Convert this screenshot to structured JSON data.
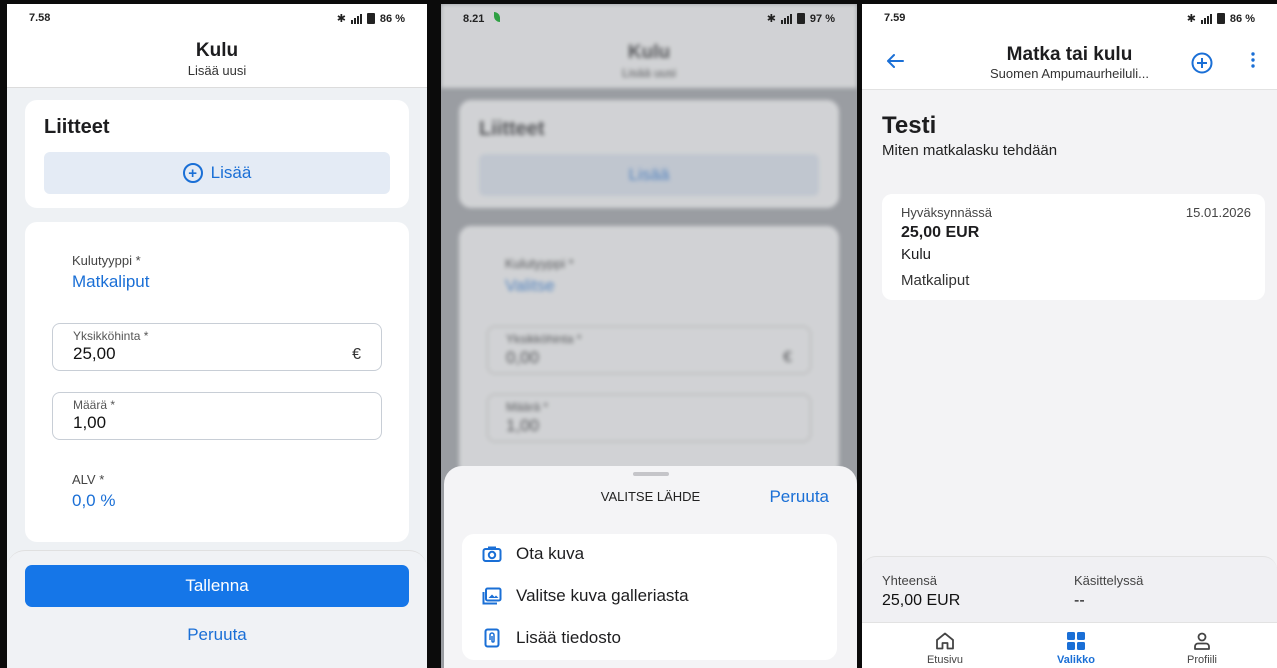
{
  "screen1": {
    "status": {
      "time": "7.58",
      "battery": "86 %"
    },
    "header": {
      "title": "Kulu",
      "subtitle": "Lisää uusi"
    },
    "attachments": {
      "title": "Liitteet",
      "add_label": "Lisää"
    },
    "form": {
      "expense_type": {
        "label": "Kulutyyppi *",
        "value": "Matkaliput"
      },
      "unit_price": {
        "label": "Yksikköhinta *",
        "value": "25,00",
        "unit": "€"
      },
      "quantity": {
        "label": "Määrä *",
        "value": "1,00"
      },
      "vat": {
        "label": "ALV *",
        "value": "0,0 %"
      }
    },
    "actions": {
      "save": "Tallenna",
      "cancel": "Peruuta"
    }
  },
  "screen2": {
    "status": {
      "time": "8.21",
      "battery": "97 %"
    },
    "background": {
      "title": "Kulu",
      "subtitle": "Lisää uusi",
      "attachments_title": "Liitteet",
      "add_label": "Lisää",
      "expense_type_label": "Kulutyyppi *",
      "expense_type_value": "Valitse",
      "unit_price_label": "Yksikköhinta *",
      "unit_price_value": "0,00",
      "unit": "€",
      "quantity_label": "Määrä *",
      "quantity_value": "1,00"
    },
    "sheet": {
      "title": "VALITSE LÄHDE",
      "cancel": "Peruuta",
      "options": [
        "Ota kuva",
        "Valitse kuva galleriasta",
        "Lisää tiedosto"
      ]
    }
  },
  "screen3": {
    "status": {
      "time": "7.59",
      "battery": "86 %"
    },
    "header": {
      "title": "Matka tai kulu",
      "subtitle": "Suomen Ampumaurheiluli..."
    },
    "trip": {
      "name": "Testi",
      "description": "Miten matkalasku tehdään"
    },
    "item": {
      "status": "Hyväksynnässä",
      "date": "15.01.2026",
      "amount": "25,00 EUR",
      "kind": "Kulu",
      "category": "Matkaliput"
    },
    "summary": {
      "total_label": "Yhteensä",
      "total_value": "25,00 EUR",
      "processing_label": "Käsittelyssä",
      "processing_value": "--"
    },
    "tabs": [
      {
        "label": "Etusivu",
        "icon": "home-icon"
      },
      {
        "label": "Valikko",
        "icon": "grid-icon"
      },
      {
        "label": "Profiili",
        "icon": "person-icon"
      }
    ],
    "active_tab": "Valikko"
  },
  "colors": {
    "accent": "#1a6fd6",
    "primary_button": "#1576e8",
    "add_button_bg": "#e4ebf5"
  }
}
